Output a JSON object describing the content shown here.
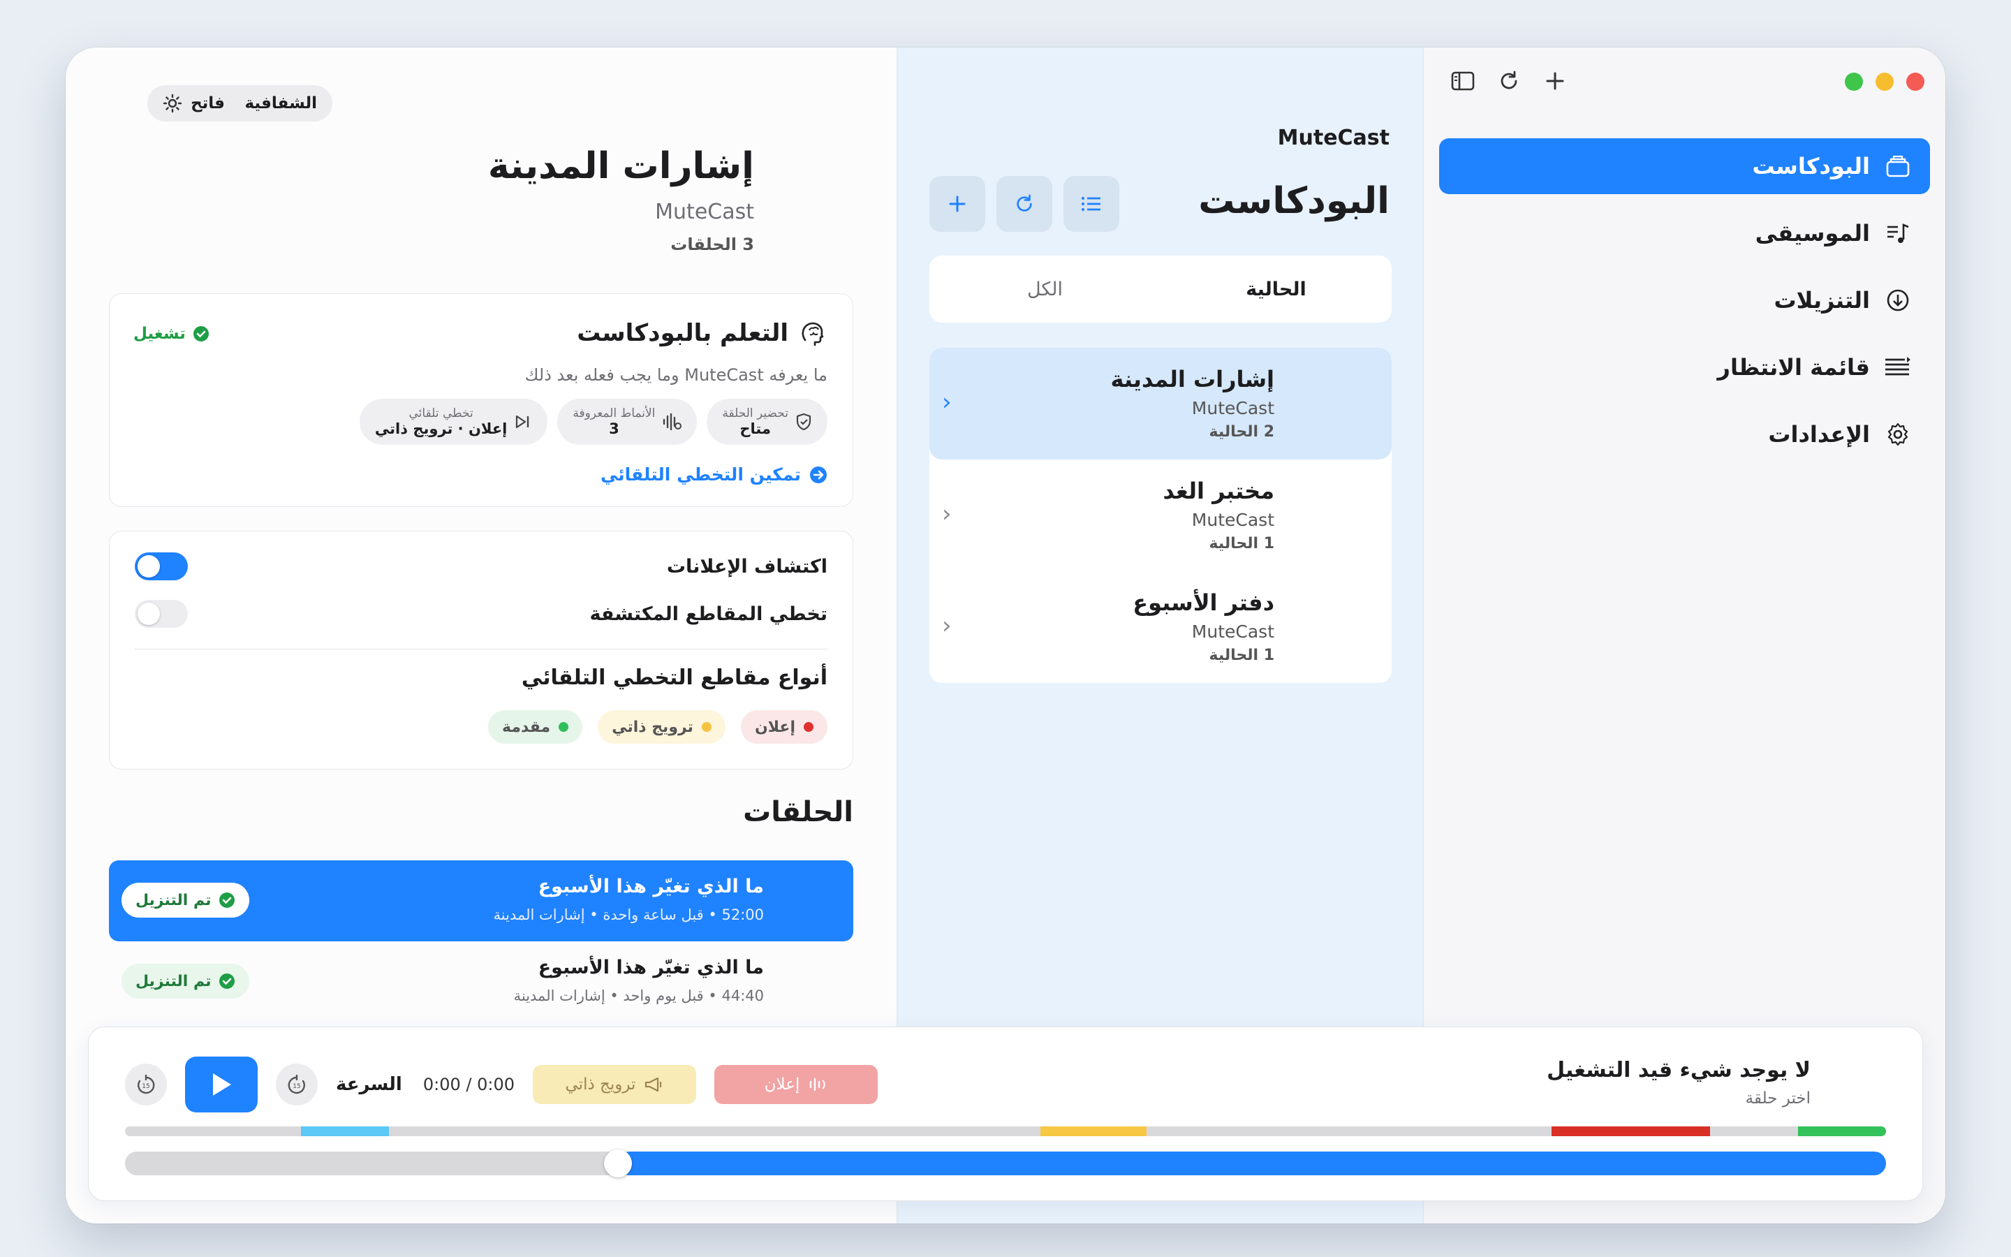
{
  "window": {
    "app_name": "MuteCast"
  },
  "sidebar": {
    "items": [
      {
        "label": "البودكاست",
        "icon": "podcasts-icon",
        "active": true
      },
      {
        "label": "الموسيقى",
        "icon": "music-icon",
        "active": false
      },
      {
        "label": "التنزيلات",
        "icon": "download-icon",
        "active": false
      },
      {
        "label": "قائمة الانتظار",
        "icon": "queue-icon",
        "active": false
      },
      {
        "label": "الإعدادات",
        "icon": "gear-icon",
        "active": false
      }
    ]
  },
  "podcasts": {
    "app_name": "MuteCast",
    "title": "البودكاست",
    "segments": {
      "current": "الحالية",
      "all": "الكل"
    },
    "list": [
      {
        "title": "إشارات المدينة",
        "author": "MuteCast",
        "count": "2 الحالية",
        "selected": true
      },
      {
        "title": "مختبر الغد",
        "author": "MuteCast",
        "count": "1 الحالية",
        "selected": false
      },
      {
        "title": "دفتر الأسبوع",
        "author": "MuteCast",
        "count": "1 الحالية",
        "selected": false
      }
    ]
  },
  "detail": {
    "transparency_label": "الشفافية",
    "theme_label": "فاتح",
    "title": "إشارات المدينة",
    "author": "MuteCast",
    "episode_count": "3 الحلقات",
    "learning": {
      "title": "التعلم بالبودكاست",
      "status": "تشغيل",
      "subtitle": "ما يعرفه MuteCast وما يجب فعله بعد ذلك",
      "stats": [
        {
          "label": "تحضير الحلقة",
          "value": "متاح"
        },
        {
          "label": "الأنماط المعروفة",
          "value": "3"
        },
        {
          "label": "تخطي تلقائي",
          "value": "إعلان · ترويج ذاتي"
        }
      ],
      "action": "تمكين التخطي التلقائي"
    },
    "settings": {
      "ad_detection": "اكتشاف الإعلانات",
      "skip_detected": "تخطي المقاطع المكتشفة",
      "types_title": "أنواع مقاطع التخطي التلقائي",
      "types": [
        {
          "label": "إعلان",
          "color": "#e03131",
          "bg": "#fbe7e7"
        },
        {
          "label": "ترويج ذاتي",
          "color": "#f5c242",
          "bg": "#fdf5dc"
        },
        {
          "label": "مقدمة",
          "color": "#2fbf5b",
          "bg": "#e6f5ea"
        }
      ]
    },
    "episodes_title": "الحلقات",
    "episodes": [
      {
        "title": "ما الذي تغيّر هذا الأسبوع",
        "meta": "52:00 • قبل ساعة واحدة • إشارات المدينة",
        "badge": "تم التنزيل"
      },
      {
        "title": "ما الذي تغيّر هذا الأسبوع",
        "meta": "44:40 • قبل يوم واحد • إشارات المدينة",
        "badge": "تم التنزيل"
      }
    ]
  },
  "player": {
    "now_playing": "لا يوجد شيء قيد التشغيل",
    "subtitle": "اختر حلقة",
    "ad_button": "إعلان",
    "promo_button": "ترويج ذاتي",
    "time": "0:00 / 0:00",
    "speed_label": "السرعة",
    "progress_fraction": 0.28,
    "segments": [
      {
        "kind": "intro",
        "color": "#33c15a",
        "start": 0.0,
        "end": 0.05
      },
      {
        "kind": "ad",
        "color": "#d93025",
        "start": 0.1,
        "end": 0.19
      },
      {
        "kind": "promo",
        "color": "#f7c843",
        "start": 0.42,
        "end": 0.48
      },
      {
        "kind": "other",
        "color": "#5bc8f5",
        "start": 0.85,
        "end": 0.9
      }
    ]
  },
  "colors": {
    "accent": "#1f82ff",
    "success": "#1e9e45"
  }
}
